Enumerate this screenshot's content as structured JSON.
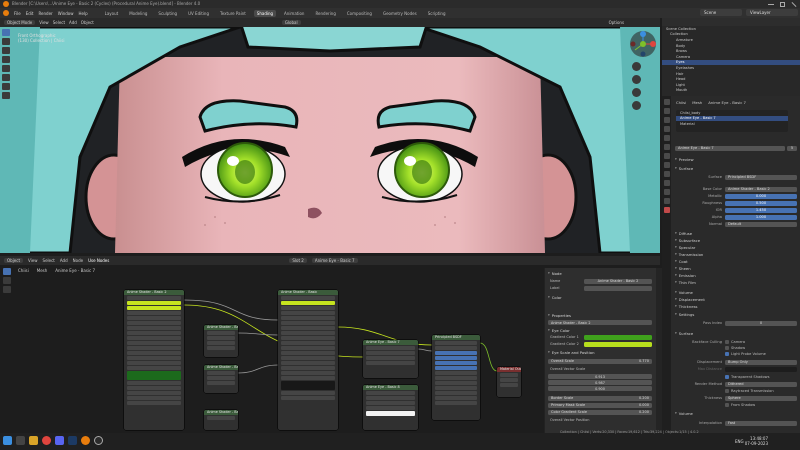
{
  "window": {
    "title": "Blender [C:\\Users\\...\\Anime Eye - Basic 2 (Cycles) (Procedural Anime Eye).blend] - Blender 4.0"
  },
  "menubar": {
    "menus": [
      "File",
      "Edit",
      "Render",
      "Window",
      "Help"
    ],
    "workspaces": [
      "Layout",
      "Modeling",
      "Sculpting",
      "UV Editing",
      "Texture Paint",
      "Shading",
      "Animation",
      "Rendering",
      "Compositing",
      "Geometry Nodes",
      "Scripting"
    ],
    "active_workspace": "Shading",
    "scene_label": "Scene",
    "view_layer_label": "ViewLayer"
  },
  "viewport": {
    "mode": "Object Mode",
    "menus": [
      "View",
      "Select",
      "Add",
      "Object"
    ],
    "orientation": "Global",
    "info_line1": "Front Orthographic",
    "info_line2": "(130) Collection | Chiisi",
    "options_label": "Options"
  },
  "outliner": {
    "rows": [
      {
        "label": "Scene Collection",
        "selected": false
      },
      {
        "label": "Collection",
        "selected": false
      },
      {
        "label": "Armature",
        "selected": false
      },
      {
        "label": "Body",
        "selected": false
      },
      {
        "label": "Brows",
        "selected": false
      },
      {
        "label": "Camera",
        "selected": false
      },
      {
        "label": "Eyes",
        "selected": true
      },
      {
        "label": "Eyelashes",
        "selected": false
      },
      {
        "label": "Hair",
        "selected": false
      },
      {
        "label": "Head",
        "selected": false
      },
      {
        "label": "Light",
        "selected": false
      },
      {
        "label": "Mouth",
        "selected": false
      }
    ]
  },
  "properties": {
    "breadcrumb": [
      "Chiisi",
      "Mesh",
      "Anime Eye - Basic 7"
    ],
    "material_slots": [
      {
        "label": "Chiisi_body",
        "selected": false
      },
      {
        "label": "Anime Eye - Basic 7",
        "selected": true
      },
      {
        "label": "Material",
        "selected": false
      }
    ],
    "material_name": "Anime Eye - Basic 7",
    "material_users": "5",
    "sections": {
      "preview": "Preview",
      "surface": "Surface",
      "diffuse": "Diffuse",
      "subsurface": "Subsurface",
      "specular": "Specular",
      "transmission": "Transmission",
      "coat": "Coat",
      "sheen": "Sheen",
      "emission": "Emission",
      "thin_film": "Thin Film",
      "volume": "Volume",
      "displacement": "Displacement",
      "thickness": "Thickness",
      "settings": "Settings",
      "surface2": "Surface",
      "volume2": "Volume"
    },
    "fields": [
      {
        "label": "Surface",
        "value": "Principled BSDF",
        "style": "plain"
      },
      {
        "label": "Base Color",
        "value": "Anime Shader - Basic 2",
        "style": "plain"
      },
      {
        "label": "Metallic",
        "value": "0.000",
        "style": "blue"
      },
      {
        "label": "Roughness",
        "value": "0.500",
        "style": "blue"
      },
      {
        "label": "IOR",
        "value": "1.450",
        "style": "blue"
      },
      {
        "label": "Alpha",
        "value": "1.000",
        "style": "blue"
      },
      {
        "label": "Normal",
        "value": "Default",
        "style": "plain"
      }
    ],
    "pass_index_label": "Pass Index",
    "pass_index_value": "0",
    "backface_culling_label": "Backface Culling",
    "camera_label": "Camera",
    "shadow_label": "Shadow",
    "light_probe_label": "Light Probe Volume",
    "displacement_label": "Displacement",
    "displacement_value": "Bump Only",
    "max_distance_label": "Max Distance",
    "transparent_shadows_label": "Transparent Shadows",
    "render_method_label": "Render Method",
    "render_method_value": "Dithered",
    "raytraced_label": "Raytraced Transmission",
    "thickness_label": "Thickness",
    "thickness_value": "Sphere",
    "from_shadow_label": "From Shadow",
    "interpolation_label": "Interpolation",
    "interpolation_value": "Fast"
  },
  "node_editor": {
    "mode": "Object",
    "menus": [
      "View",
      "Select",
      "Add",
      "Node"
    ],
    "use_nodes_label": "Use Nodes",
    "slot_label": "Slot 2",
    "material_name": "Anime Eye - Basic 7",
    "breadcrumb": [
      "Chiisi",
      "Mesh",
      "Anime Eye - Basic 7"
    ],
    "nodes": [
      {
        "title": "Anime Shader - Basic 2",
        "color": "g"
      },
      {
        "title": "Anime Shader - Basic",
        "color": "g"
      },
      {
        "title": "Anime Shader - Basic",
        "color": "g"
      },
      {
        "title": "Anime Shader - Basic",
        "color": "g"
      },
      {
        "title": "Anime Shader - Basic",
        "color": "g"
      },
      {
        "title": "Anime Eye - Basic 7",
        "color": "g"
      },
      {
        "title": "Anime Eye - Basic 8",
        "color": "g"
      },
      {
        "title": "Principled BSDF",
        "color": "g"
      },
      {
        "title": "Material Output",
        "color": "r"
      }
    ]
  },
  "npanel": {
    "node_section": "Node",
    "name_label": "Name",
    "name_value": "Anime Shader - Basic 2",
    "label_label": "Label",
    "color_section": "Color",
    "properties_section": "Properties",
    "properties_value": "Anime Shader - Basic 2",
    "eye_color_section": "Eye Color",
    "gradient_color1_label": "Gradient Color 1",
    "gradient_color2_label": "Gradient Color 2",
    "eye_scale_section": "Eye Scale and Position",
    "overall_scale_label": "Overall Scale",
    "overall_scale_value": "0.770",
    "overall_vector_scale_label": "Overall Vector Scale",
    "vector_values": [
      "0.913",
      "0.987",
      "0.900"
    ],
    "border_scale_label": "Border Scale",
    "border_scale_value": "0.200",
    "primary_mask_label": "Primary Mask Scale",
    "primary_mask_value": "0.000",
    "color_gradient_label": "Color Gradient Scale",
    "color_gradient_value": "0.200",
    "overall_vector_position_label": "Overall Vector Position"
  },
  "statusbar": {
    "text": "Collection | Chiisi | Verts:20,330 | Faces:19,612 | Tris:39,224 | Objects:1/15 | 4.0.2",
    "time": "13:48:07",
    "date": "07-09-2023",
    "lang": "ENG"
  },
  "colors": {
    "accent": "#4772b3",
    "hair": "#7fd1cf",
    "skin": "#e9b5b9",
    "iris": "#9fdc25",
    "gradient1": "#3fa11c",
    "gradient2": "#b7de1d",
    "blender_orange": "#e87d0d"
  }
}
